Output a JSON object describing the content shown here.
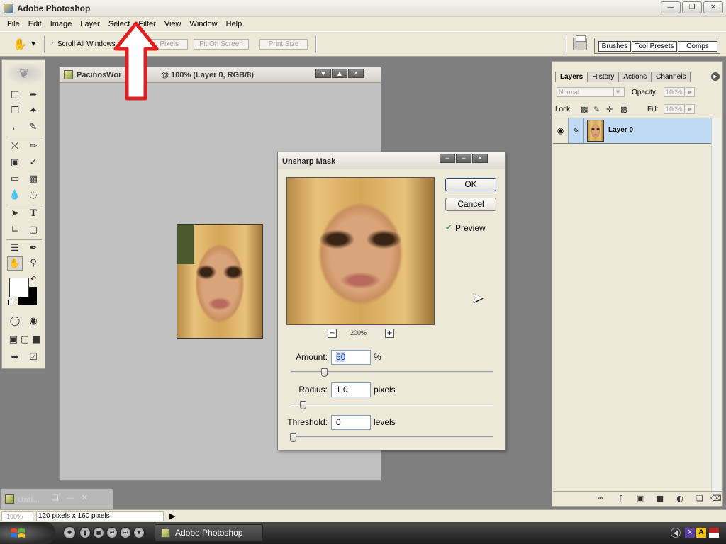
{
  "window": {
    "title": "Adobe Photoshop",
    "controls": [
      "—",
      "❐",
      "✕"
    ]
  },
  "menu": [
    "File",
    "Edit",
    "Image",
    "Layer",
    "Select",
    "Filter",
    "View",
    "Window",
    "Help"
  ],
  "options": {
    "scroll_all_label": "Scroll All Windows",
    "actual_pixels": "Pixels",
    "fit_on_screen": "Fit On Screen",
    "print_size": "Print Size"
  },
  "palette_well": {
    "tabs": [
      "Brushes",
      "Tool Presets",
      "Comps"
    ]
  },
  "document": {
    "title_left": "PacinosWor",
    "title_right": "@ 100% (Layer 0, RGB/8)"
  },
  "dialog": {
    "title": "Unsharp Mask",
    "ok": "OK",
    "cancel": "Cancel",
    "preview_label": "Preview",
    "preview_checked": true,
    "zoom_minus": "−",
    "zoom_plus": "+",
    "zoom_level": "200%",
    "amount": {
      "label": "Amount:",
      "value": "50",
      "unit": "%",
      "fraction": 0.155
    },
    "radius": {
      "label": "Radius:",
      "value": "1,0",
      "unit": "pixels",
      "fraction": 0.05
    },
    "threshold": {
      "label": "Threshold:",
      "value": "0",
      "unit": "levels",
      "fraction": 0.0
    }
  },
  "layers_panel": {
    "tabs": [
      "Layers",
      "History",
      "Actions",
      "Channels"
    ],
    "active_tab": "Layers",
    "blend_mode": "Normal",
    "opacity_label": "Opacity:",
    "opacity_value": "100%",
    "lock_label": "Lock:",
    "fill_label": "Fill:",
    "fill_value": "100%",
    "layers": [
      {
        "name": "Layer 0",
        "visible": true,
        "selected": true
      }
    ]
  },
  "minimized_doc": {
    "title": "Unti..."
  },
  "status": {
    "zoom": "100%",
    "info": "120 pixels x 160 pixels"
  },
  "taskbar": {
    "task_label": "Adobe Photoshop"
  },
  "colors": {
    "workspace": "#7f7f7f",
    "ui_face": "#ece9d8",
    "layer_selected": "#c1dbf6",
    "annotation_arrow": "#e02020"
  }
}
